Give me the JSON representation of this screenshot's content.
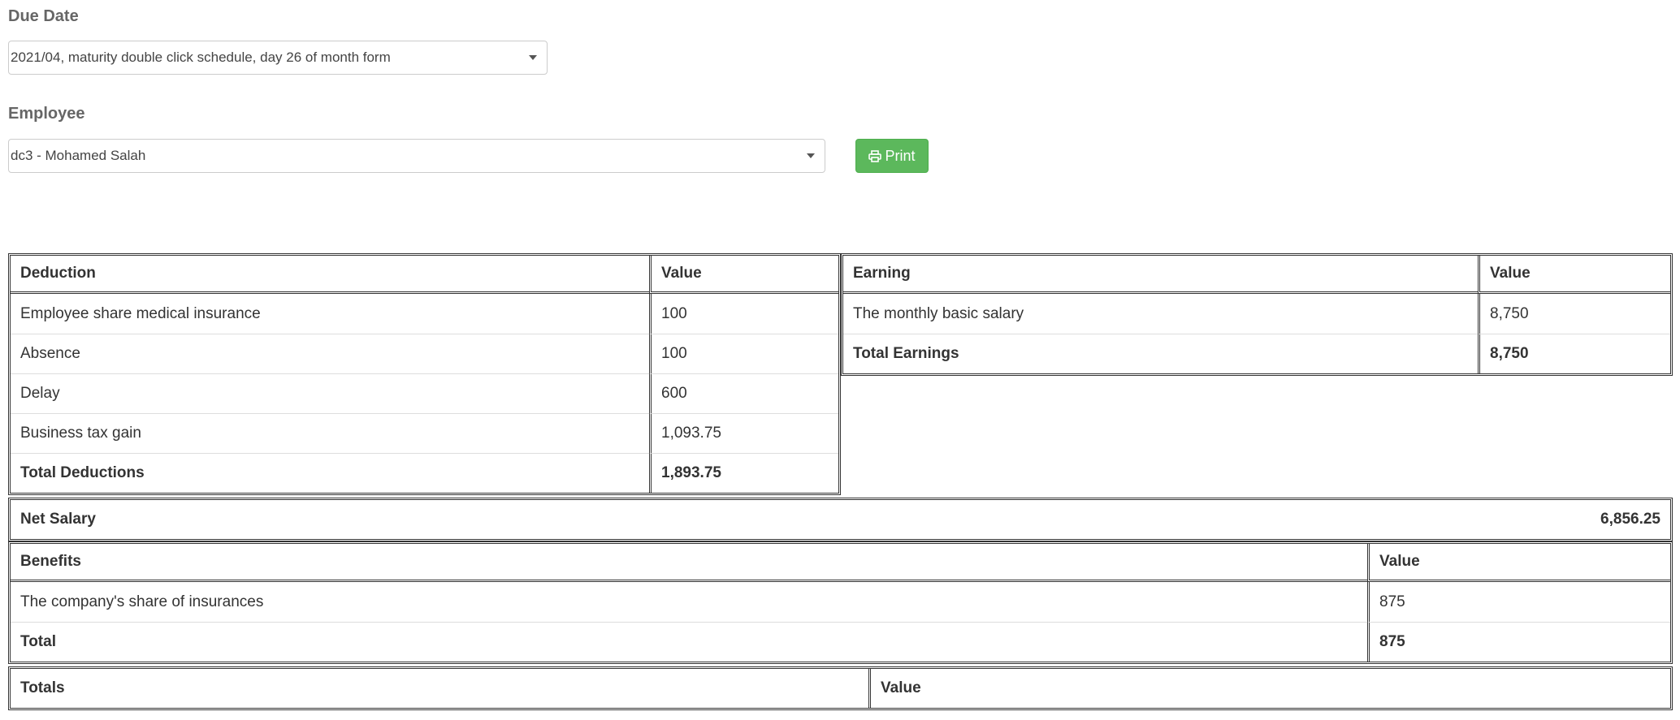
{
  "due_date": {
    "label": "Due Date",
    "selected": "2021/04, maturity double click schedule, day 26 of month form"
  },
  "employee": {
    "label": "Employee",
    "selected": "dc3 - Mohamed Salah"
  },
  "print_button": {
    "label": "Print",
    "icon": "printer-icon",
    "color": "#5cb85c"
  },
  "deductions": {
    "header_name": "Deduction",
    "header_value": "Value",
    "rows": [
      {
        "name": "Employee share medical insurance",
        "value": "100"
      },
      {
        "name": "Absence",
        "value": "100"
      },
      {
        "name": "Delay",
        "value": "600"
      },
      {
        "name": "Business tax gain",
        "value": "1,093.75"
      }
    ],
    "total_label": "Total Deductions",
    "total_value": "1,893.75"
  },
  "earnings": {
    "header_name": "Earning",
    "header_value": "Value",
    "rows": [
      {
        "name": "The monthly basic salary",
        "value": "8,750"
      }
    ],
    "total_label": "Total Earnings",
    "total_value": "8,750"
  },
  "net_salary": {
    "label": "Net Salary",
    "value": "6,856.25"
  },
  "benefits": {
    "header_name": "Benefits",
    "header_value": "Value",
    "rows": [
      {
        "name": "The company's share of insurances",
        "value": "875"
      }
    ],
    "total_label": "Total",
    "total_value": "875"
  },
  "totals": {
    "header_name": "Totals",
    "header_value": "Value"
  }
}
